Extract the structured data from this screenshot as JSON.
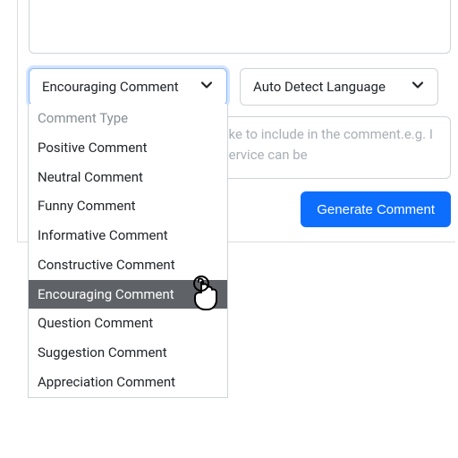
{
  "typeSelect": {
    "selected": "Encouraging Comment",
    "placeholder": "Comment Type",
    "options": [
      "Positive Comment",
      "Neutral Comment",
      "Funny Comment",
      "Informative Comment",
      "Constructive Comment",
      "Encouraging Comment",
      "Question Comment",
      "Suggestion Comment",
      "Appreciation Comment"
    ],
    "highlighted": "Encouraging Comment"
  },
  "langSelect": {
    "selected": "Auto Detect Language"
  },
  "detailsPlaceholder": "Enter the specific details you'd like to include in the comment.e.g. I want to briefly explain how my service can be",
  "generateBtn": "Generate Comment"
}
